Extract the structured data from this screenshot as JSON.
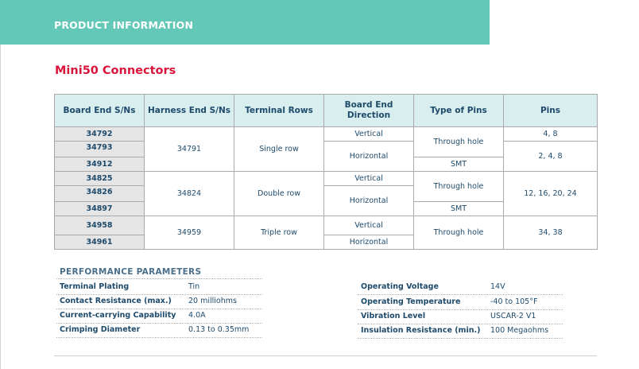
{
  "header": {
    "title": "PRODUCT INFORMATION"
  },
  "page_title": "Mini50 Connectors",
  "table": {
    "headers": [
      "Board End S/Ns",
      "Harness End S/Ns",
      "Terminal Rows",
      "Board End Direction",
      "Type of Pins",
      "Pins"
    ],
    "groups": [
      {
        "board_sns": [
          "34792",
          "34793",
          "34912"
        ],
        "harness_sn": "34791",
        "rows": "Single row",
        "directions": [
          "Vertical",
          "Horizontal"
        ],
        "pin_types": [
          "Through hole",
          "SMT"
        ],
        "pins": [
          "4, 8",
          "2, 4, 8"
        ]
      },
      {
        "board_sns": [
          "34825",
          "34826",
          "34897"
        ],
        "harness_sn": "34824",
        "rows": "Double row",
        "directions": [
          "Vertical",
          "Horizontal"
        ],
        "pin_types": [
          "Through hole",
          "SMT"
        ],
        "pins": [
          "12, 16, 20, 24"
        ]
      },
      {
        "board_sns": [
          "34958",
          "34961"
        ],
        "harness_sn": "34959",
        "rows": "Triple row",
        "directions": [
          "Vertical",
          "Horizontal"
        ],
        "pin_types": [
          "Through hole"
        ],
        "pins": [
          "34, 38"
        ]
      }
    ]
  },
  "performance": {
    "title": "PERFORMANCE PARAMETERS",
    "left": [
      {
        "label": "Terminal Plating",
        "value": "Tin"
      },
      {
        "label": "Contact Resistance (max.)",
        "value": "20 milliohms"
      },
      {
        "label": "Current-carrying Capability",
        "value": "4.0A"
      },
      {
        "label": "Crimping Diameter",
        "value": "0.13 to 0.35mm"
      }
    ],
    "right": [
      {
        "label": "Operating Voltage",
        "value": "14V"
      },
      {
        "label": "Operating Temperature",
        "value": "-40 to 105°F"
      },
      {
        "label": "Vibration Level",
        "value": "USCAR-2 V1"
      },
      {
        "label": "Insulation Resistance (min.)",
        "value": "100 Megaohms"
      }
    ]
  }
}
